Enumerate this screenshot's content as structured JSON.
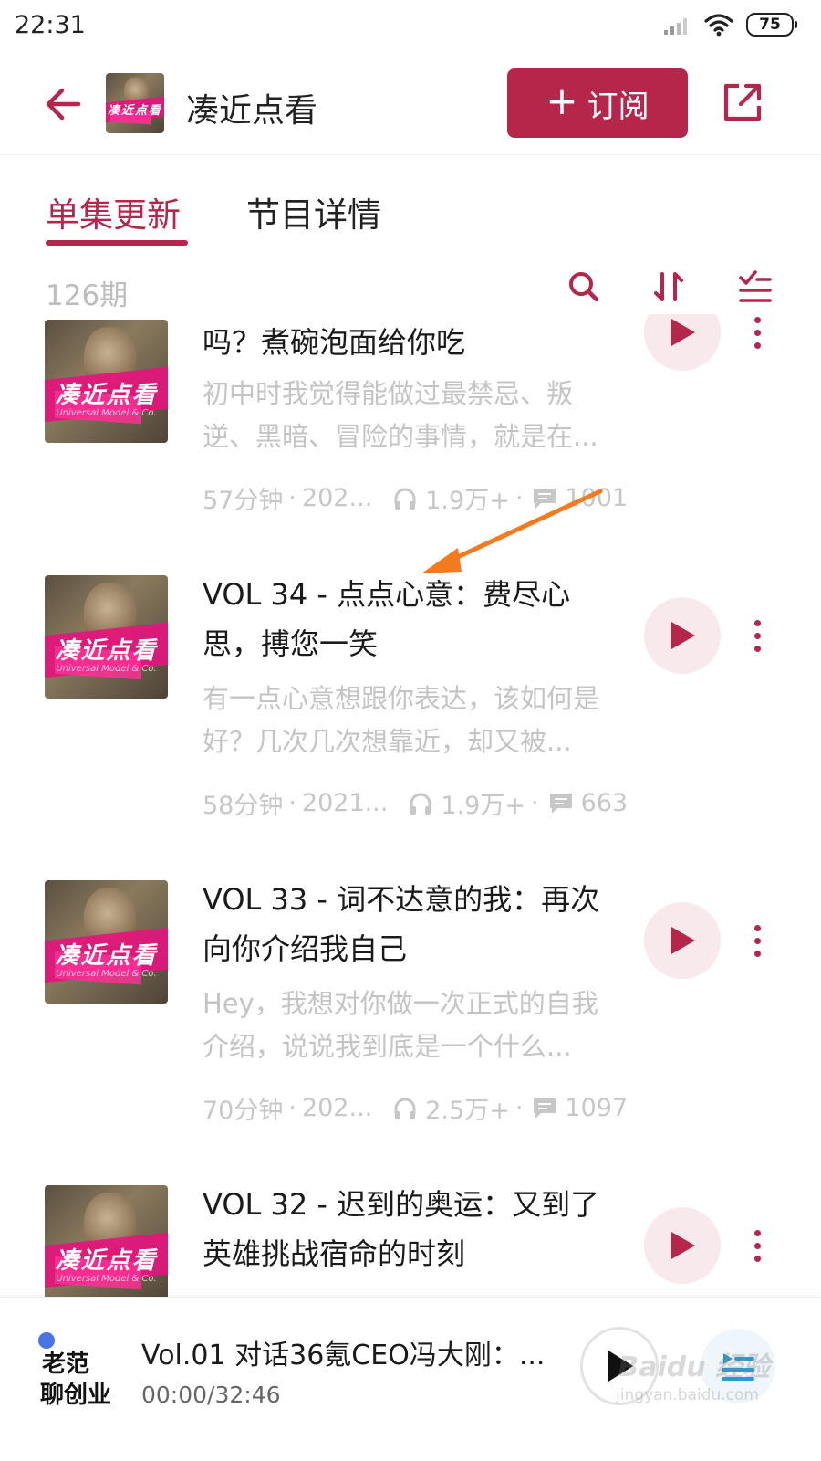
{
  "status_bar": {
    "time": "22:31",
    "battery": "75"
  },
  "header": {
    "title": "凑近点看",
    "cover_label": "凑近点看",
    "subscribe_plus": "+",
    "subscribe_label": "订阅"
  },
  "tabs": {
    "episodes": "单集更新",
    "details": "节目详情"
  },
  "list_header": {
    "count": "126期"
  },
  "cover": {
    "title": "凑近点看",
    "sub": "Universal Model & Co."
  },
  "episodes": [
    {
      "title": "吗？煮碗泡面给你吃",
      "desc": "初中时我觉得能做过最禁忌、叛逆、黑暗、冒险的事情，就是在...",
      "duration": "57分钟",
      "date": "202...",
      "plays": "1.9万+",
      "comments": "1001"
    },
    {
      "title": "VOL 34 - 点点心意：费尽心思，搏您一笑",
      "desc": "有一点心意想跟你表达，该如何是好？几次几次想靠近，却又被...",
      "duration": "58分钟",
      "date": "2021...",
      "plays": "1.9万+",
      "comments": "663"
    },
    {
      "title": "VOL 33 - 词不达意的我：再次向你介绍我自己",
      "desc": "Hey，我想对你做一次正式的自我介绍，说说我到底是一个什么...",
      "duration": "70分钟",
      "date": "202...",
      "plays": "2.5万+",
      "comments": "1097"
    },
    {
      "title": "VOL 32 - 迟到的奥运：又到了英雄挑战宿命的时刻",
      "desc": "",
      "duration": "",
      "date": "",
      "plays": "",
      "comments": ""
    }
  ],
  "mini_player": {
    "logo_line1": "老范",
    "logo_line2": "聊创业",
    "title": "Vol.01 对话36氪CEO冯大刚：...",
    "time": "00:00/32:46"
  },
  "watermark": {
    "main": "Baidu 经验",
    "sub": "jingyan.baidu.com"
  },
  "colors": {
    "accent": "#b5264a",
    "play_bg": "#f7e9ec",
    "annotation": "#f47a20",
    "muted_text": "#c4c4c4"
  }
}
